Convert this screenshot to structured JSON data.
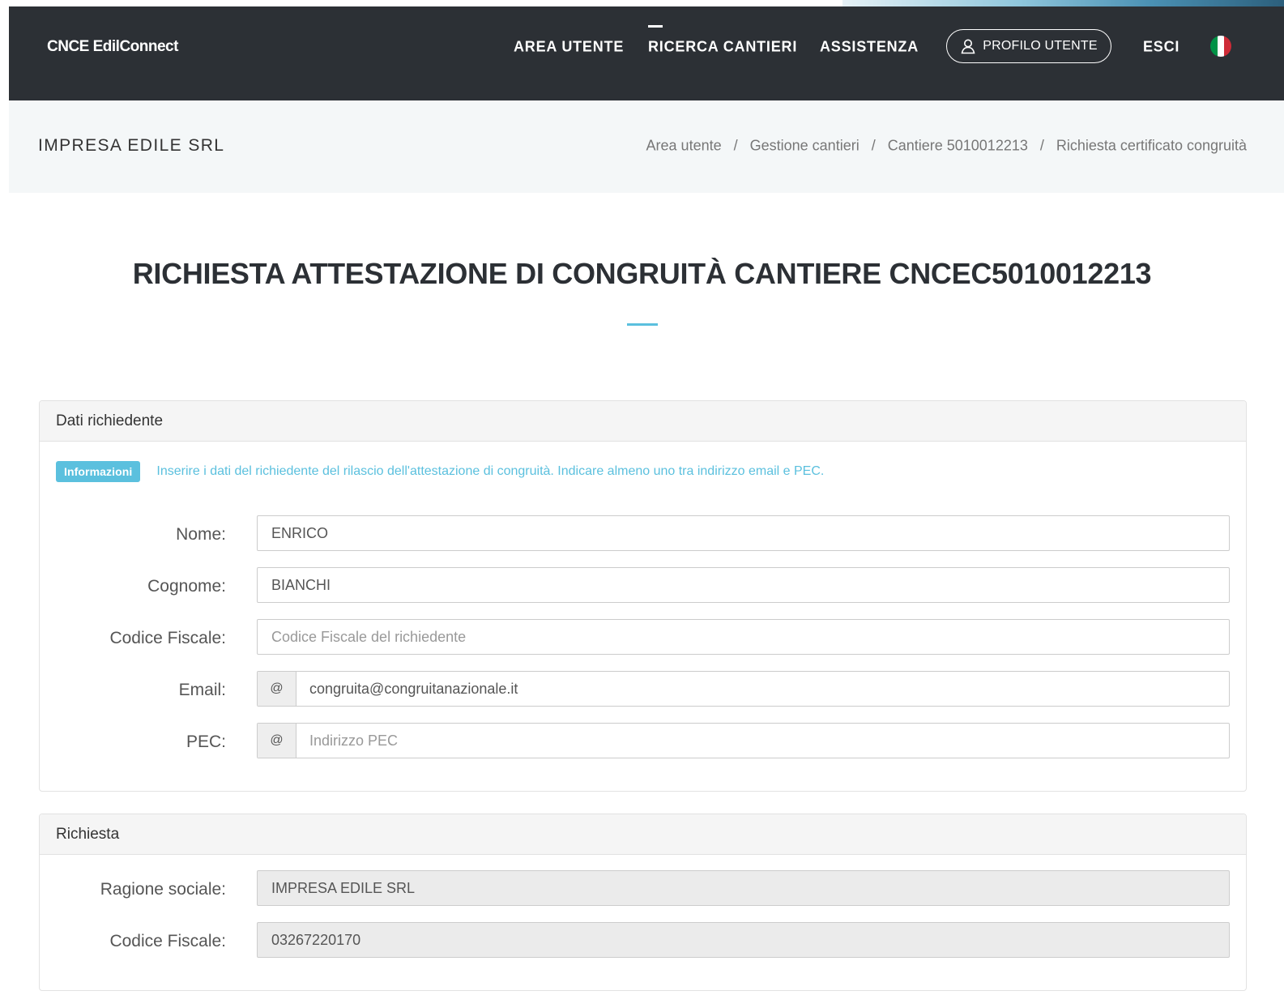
{
  "header": {
    "brand": "CNCE EdilConnect",
    "nav": [
      {
        "label": "AREA UTENTE"
      },
      {
        "label": "RICERCA CANTIERI"
      },
      {
        "label": "ASSISTENZA"
      }
    ],
    "profile_label": "PROFILO UTENTE",
    "logout_label": "ESCI",
    "flag_colors": [
      "#009246",
      "#ffffff",
      "#ce2b37"
    ]
  },
  "subheader": {
    "company": "IMPRESA EDILE SRL",
    "breadcrumb": [
      "Area utente",
      "Gestione cantieri",
      "Cantiere 5010012213",
      "Richiesta certificato congruità"
    ],
    "separator": "/"
  },
  "page": {
    "title": "RICHIESTA ATTESTAZIONE DI CONGRUITÀ CANTIERE CNCEC5010012213"
  },
  "dati_richiedente": {
    "heading": "Dati richiedente",
    "badge": "Informazioni",
    "info": "Inserire i dati del richiedente del rilascio dell'attestazione di congruità. Indicare almeno uno tra indirizzo email e PEC.",
    "fields": {
      "nome": {
        "label": "Nome:",
        "value": "ENRICO"
      },
      "cognome": {
        "label": "Cognome:",
        "value": "BIANCHI"
      },
      "codice_fiscale": {
        "label": "Codice Fiscale:",
        "value": "",
        "placeholder": "Codice Fiscale del richiedente"
      },
      "email": {
        "label": "Email:",
        "addon": "@",
        "value": "congruita@congruitanazionale.it"
      },
      "pec": {
        "label": "PEC:",
        "addon": "@",
        "value": "",
        "placeholder": "Indirizzo PEC"
      }
    }
  },
  "richiesta": {
    "heading": "Richiesta",
    "fields": {
      "ragione_sociale": {
        "label": "Ragione sociale:",
        "value": "IMPRESA EDILE SRL"
      },
      "codice_fiscale": {
        "label": "Codice Fiscale:",
        "value": "03267220170"
      }
    }
  },
  "colors": {
    "navbar": "#2c3035",
    "accent": "#5bc0de",
    "subheader_bg": "#f4f7f8"
  }
}
